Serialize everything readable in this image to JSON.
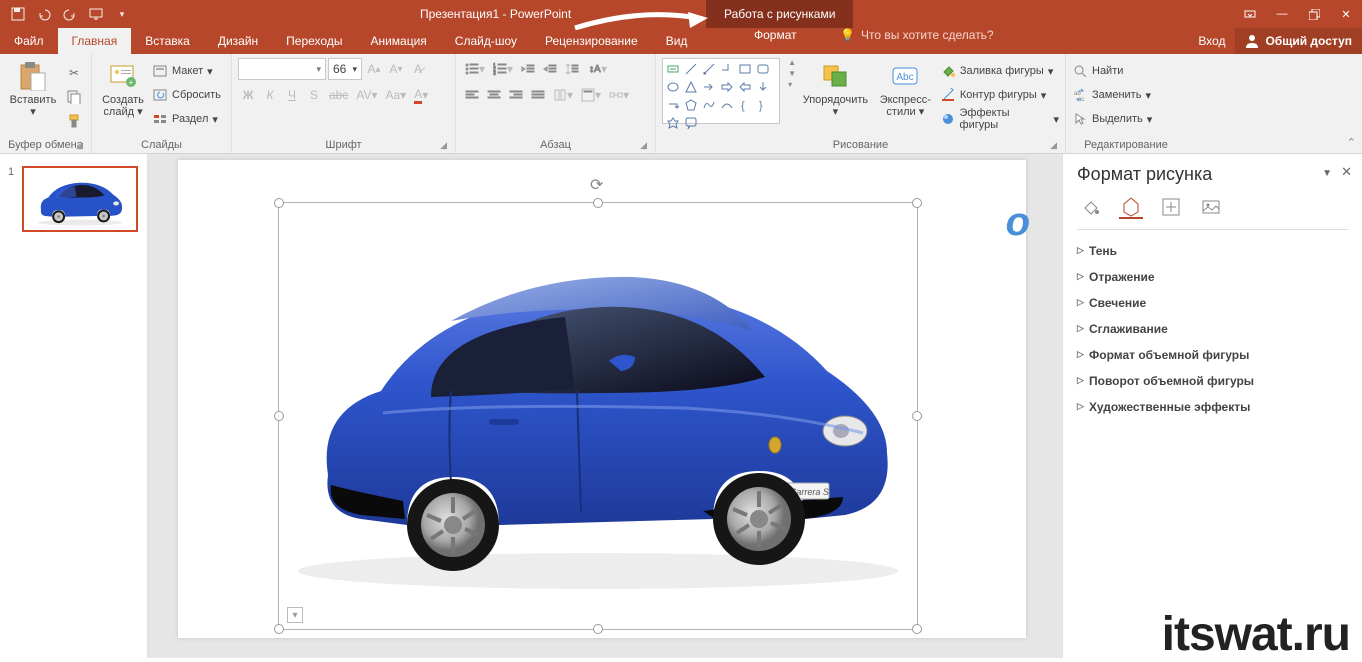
{
  "titlebar": {
    "title": "Презентация1 - PowerPoint",
    "context_tab": "Работа с рисунками"
  },
  "tabs": {
    "file": "Файл",
    "home": "Главная",
    "insert": "Вставка",
    "design": "Дизайн",
    "transitions": "Переходы",
    "animations": "Анимация",
    "slideshow": "Слайд-шоу",
    "review": "Рецензирование",
    "view": "Вид",
    "format": "Формат",
    "tellme": "Что вы хотите сделать?",
    "signin": "Вход",
    "share": "Общий доступ"
  },
  "ribbon": {
    "clipboard": {
      "label": "Буфер обмена",
      "paste": "Вставить"
    },
    "slides": {
      "label": "Слайды",
      "new_slide": "Создать слайд",
      "layout": "Макет",
      "reset": "Сбросить",
      "section": "Раздел"
    },
    "font": {
      "label": "Шрифт",
      "size": "66"
    },
    "paragraph": {
      "label": "Абзац"
    },
    "drawing": {
      "label": "Рисование",
      "arrange": "Упорядочить",
      "quick_styles": "Экспресс-стили",
      "fill": "Заливка фигуры",
      "outline": "Контур фигуры",
      "effects": "Эффекты фигуры"
    },
    "editing": {
      "label": "Редактирование",
      "find": "Найти",
      "replace": "Заменить",
      "select": "Выделить"
    }
  },
  "thumbnails": {
    "slide1_num": "1"
  },
  "format_pane": {
    "title": "Формат рисунка",
    "items": [
      "Тень",
      "Отражение",
      "Свечение",
      "Сглаживание",
      "Формат объемной фигуры",
      "Поворот объемной фигуры",
      "Художественные эффекты"
    ]
  },
  "watermark": "itswat.ru"
}
